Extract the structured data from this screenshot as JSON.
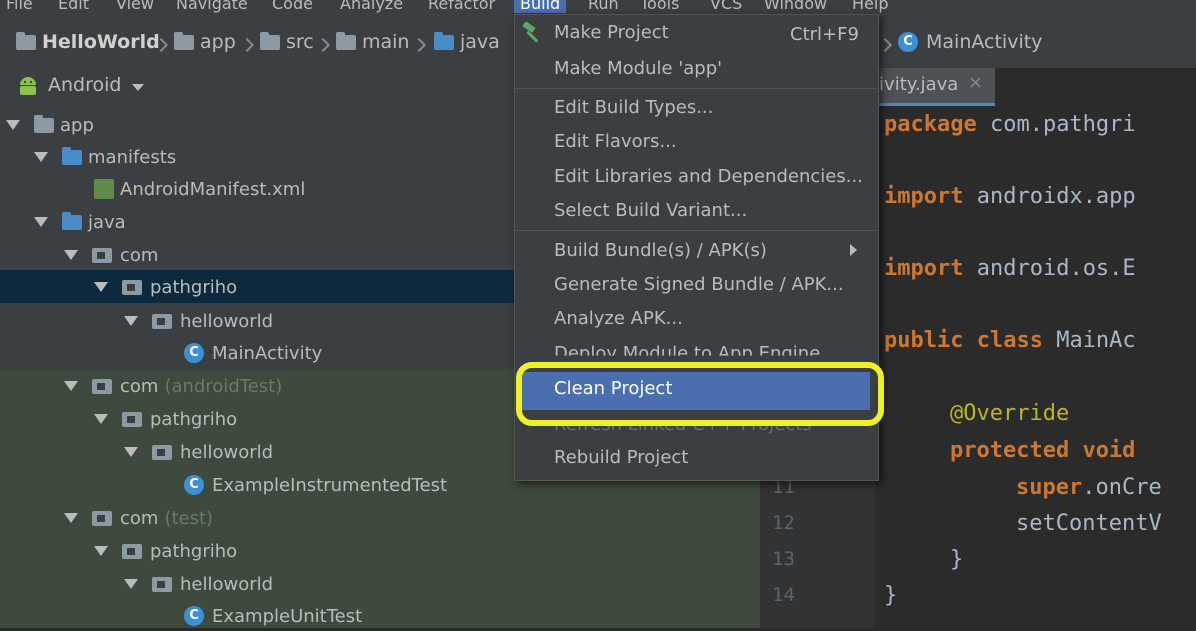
{
  "menubar": {
    "items": [
      {
        "label": "File",
        "active": false
      },
      {
        "label": "Edit",
        "active": false
      },
      {
        "label": "View",
        "active": false
      },
      {
        "label": "Navigate",
        "active": false
      },
      {
        "label": "Code",
        "active": false
      },
      {
        "label": "Analyze",
        "active": false
      },
      {
        "label": "Refactor",
        "active": false
      },
      {
        "label": "Build",
        "active": true
      },
      {
        "label": "Run",
        "active": false
      },
      {
        "label": "Tools",
        "active": false
      },
      {
        "label": "VCS",
        "active": false
      },
      {
        "label": "Window",
        "active": false
      },
      {
        "label": "Help",
        "active": false
      }
    ]
  },
  "breadcrumb": {
    "items": [
      "HelloWorld",
      "app",
      "src",
      "main",
      "java"
    ],
    "file": "MainActivity"
  },
  "project_panel": {
    "view_label": "Android",
    "tree": [
      {
        "label": "app",
        "suffix": ""
      },
      {
        "label": "manifests",
        "suffix": ""
      },
      {
        "label": "AndroidManifest.xml",
        "suffix": ""
      },
      {
        "label": "java",
        "suffix": ""
      },
      {
        "label": "com",
        "suffix": ""
      },
      {
        "label": "pathgriho",
        "suffix": ""
      },
      {
        "label": "helloworld",
        "suffix": ""
      },
      {
        "label": "MainActivity",
        "suffix": ""
      },
      {
        "label": "com",
        "suffix": "(androidTest)"
      },
      {
        "label": "pathgriho",
        "suffix": ""
      },
      {
        "label": "helloworld",
        "suffix": ""
      },
      {
        "label": "ExampleInstrumentedTest",
        "suffix": ""
      },
      {
        "label": "com",
        "suffix": "(test)"
      },
      {
        "label": "pathgriho",
        "suffix": ""
      },
      {
        "label": "helloworld",
        "suffix": ""
      },
      {
        "label": "ExampleUnitTest",
        "suffix": ""
      }
    ]
  },
  "editor": {
    "tab_label": "tivity.java",
    "code_lines": [
      {
        "kw": "package",
        "rest": " com.pathgri"
      },
      {
        "kw": "import",
        "rest": " androidx.app"
      },
      {
        "kw": "import",
        "rest": " android.os.E"
      },
      {
        "kw": "public class",
        "rest": " MainAc"
      },
      {
        "kw": "@Override",
        "rest": ""
      },
      {
        "kw": "protected void",
        "rest": ""
      },
      {
        "kw": "super",
        "rest": ".onCre"
      },
      {
        "kw": "",
        "rest": "setContentV"
      },
      {
        "kw": "",
        "rest": "}"
      },
      {
        "kw": "",
        "rest": "}"
      }
    ],
    "line_numbers": [
      "11",
      "12",
      "13",
      "14"
    ]
  },
  "build_menu": {
    "items": [
      {
        "label": "Make Project",
        "shortcut": "Ctrl+F9"
      },
      {
        "label": "Make Module 'app'"
      },
      {
        "label": "Edit Build Types..."
      },
      {
        "label": "Edit Flavors..."
      },
      {
        "label": "Edit Libraries and Dependencies..."
      },
      {
        "label": "Select Build Variant..."
      },
      {
        "label": "Build Bundle(s) / APK(s)"
      },
      {
        "label": "Generate Signed Bundle / APK..."
      },
      {
        "label": "Analyze APK..."
      },
      {
        "label": "Deploy Module to App Engine..."
      },
      {
        "label": "Clean Project"
      },
      {
        "label": "Refresh Linked C++ Projects"
      },
      {
        "label": "Rebuild Project"
      }
    ],
    "highlighted": "Clean Project"
  },
  "colors": {
    "highlight_ring": "#f0f028",
    "selection": "#4b6eaf"
  }
}
